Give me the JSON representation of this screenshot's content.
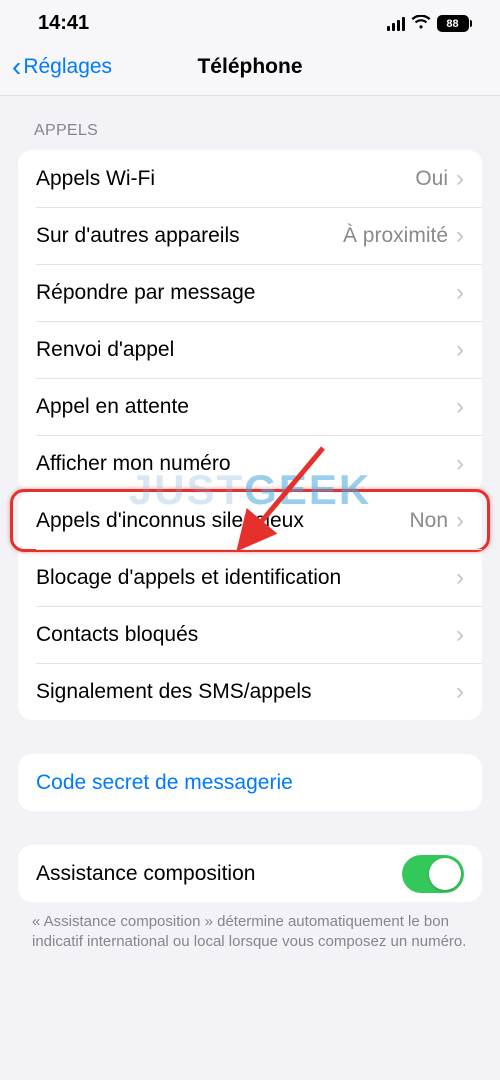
{
  "status": {
    "time": "14:41",
    "battery": "88"
  },
  "nav": {
    "back": "Réglages",
    "title": "Téléphone"
  },
  "section_calls_header": "APPELS",
  "calls": {
    "items": [
      {
        "label": "Appels Wi-Fi",
        "value": "Oui"
      },
      {
        "label": "Sur d'autres appareils",
        "value": "À proximité"
      },
      {
        "label": "Répondre par message",
        "value": ""
      },
      {
        "label": "Renvoi d'appel",
        "value": ""
      },
      {
        "label": "Appel en attente",
        "value": ""
      },
      {
        "label": "Afficher mon numéro",
        "value": ""
      }
    ]
  },
  "blocking": {
    "items": [
      {
        "label": "Appels d'inconnus silencieux",
        "value": "Non"
      },
      {
        "label": "Blocage d'appels et identification",
        "value": ""
      },
      {
        "label": "Contacts bloqués",
        "value": ""
      },
      {
        "label": "Signalement des SMS/appels",
        "value": ""
      }
    ]
  },
  "voicemail": {
    "link_label": "Code secret de messagerie"
  },
  "assist": {
    "label": "Assistance composition",
    "footer": "« Assistance composition » détermine automatiquement le bon indicatif international ou local lorsque vous composez un numéro."
  },
  "watermark": {
    "left": "JUST",
    "right": "GEEK"
  }
}
